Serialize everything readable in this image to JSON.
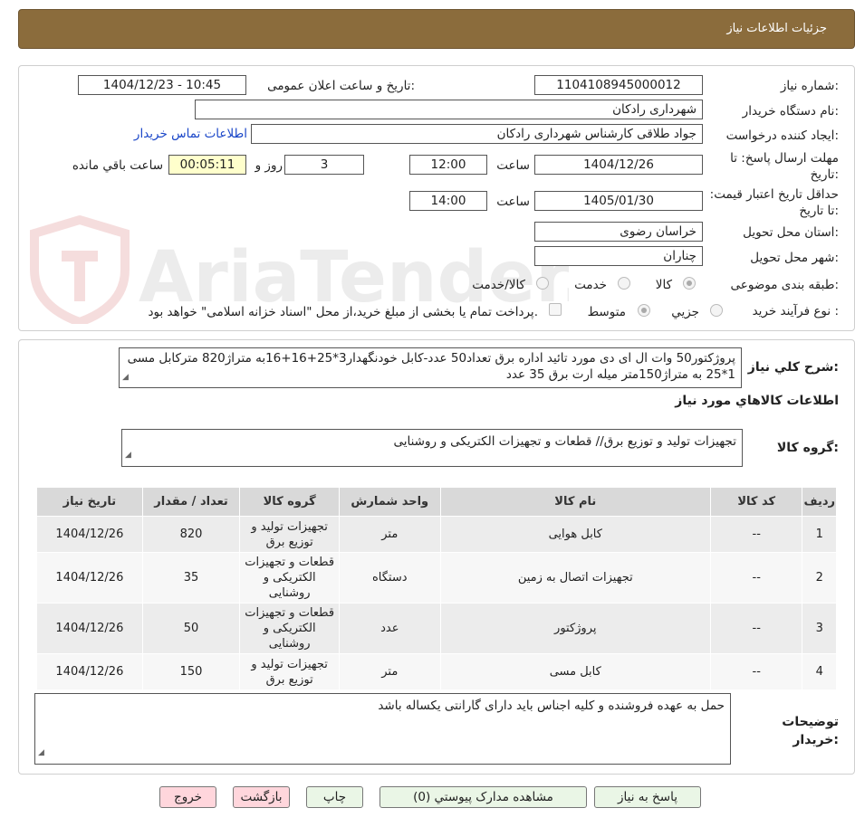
{
  "header": {
    "title": "جزئیات اطلاعات نیاز"
  },
  "labels": {
    "need_number": "شماره نیاز:",
    "announce_datetime": "تاریخ و ساعت اعلان عمومی:",
    "buyer_org": "نام دستگاه خریدار:",
    "requester": "ایجاد کننده درخواست:",
    "contact_link": "اطلاعات تماس خریدار",
    "reply_deadline": "مهلت ارسال پاسخ: تا تاریخ:",
    "time_word": "ساعت",
    "days_and": "روز و",
    "remaining": "ساعت باقي مانده",
    "validity": "حداقل تاریخ اعتبار قیمت: تا تاریخ:",
    "province": "استان محل تحویل:",
    "city": "شهر محل تحویل:",
    "category": "طبقه بندی موضوعی:",
    "process": "نوع فرآیند خرید :",
    "general_desc": "شرح کلي نياز:",
    "goods_info": "اطلاعات کالاهاي مورد نياز",
    "goods_group": "گروه کالا:",
    "buyer_notes": "توضیحات خریدار:"
  },
  "values": {
    "need_number": "1104108945000012",
    "announce_datetime": "1404/12/23 - 10:45",
    "buyer_org": "شهرداری رادکان",
    "requester": "جواد طلاقی کارشناس شهرداری رادکان",
    "reply_date": "1404/12/26",
    "reply_time": "12:00",
    "days": "3",
    "remaining_time": "00:05:11",
    "validity_date": "1405/01/30",
    "validity_time": "14:00",
    "province": "خراسان رضوی",
    "city": "چناران"
  },
  "category_options": [
    {
      "label": "کالا",
      "selected": true
    },
    {
      "label": "خدمت",
      "selected": false
    },
    {
      "label": "کالا/خدمت",
      "selected": false
    }
  ],
  "process_options": [
    {
      "label": "جزیي",
      "selected": false
    },
    {
      "label": "متوسط",
      "selected": true
    }
  ],
  "process_note": "پرداخت تمام یا بخشی از مبلغ خرید،از محل \"اسناد خزانه اسلامی\" خواهد بود.",
  "general_desc_text": "پروژکتور50 وات ال ای دی مورد تائید اداره برق تعداد50 عدد-کابل خودنگهدار3*25+16+16به متراژ820 متر‌کابل مسی 1*25 به متراژ150متر میله ارت برق 35 عدد",
  "goods_group_text": "تجهیزات تولید و توزیع برق// قطعات و تجهیزات الکتریکی و روشنایی",
  "table": {
    "headers": [
      "ردیف",
      "کد کالا",
      "نام کالا",
      "واحد شمارش",
      "گروه کالا",
      "تعداد / مقدار",
      "تاریخ نیاز"
    ],
    "rows": [
      {
        "idx": "1",
        "code": "--",
        "name": "کابل هوایی",
        "unit": "متر",
        "group": "تجهیزات تولید و توزیع برق",
        "qty": "820",
        "date": "1404/12/26"
      },
      {
        "idx": "2",
        "code": "--",
        "name": "تجهیزات اتصال به زمین",
        "unit": "دستگاه",
        "group": "قطعات و تجهیزات الکتریکی و روشنایی",
        "qty": "35",
        "date": "1404/12/26"
      },
      {
        "idx": "3",
        "code": "--",
        "name": "پروژکتور",
        "unit": "عدد",
        "group": "قطعات و تجهیزات الکتریکی و روشنایی",
        "qty": "50",
        "date": "1404/12/26"
      },
      {
        "idx": "4",
        "code": "--",
        "name": "کابل مسی",
        "unit": "متر",
        "group": "تجهیزات تولید و توزیع برق",
        "qty": "150",
        "date": "1404/12/26"
      }
    ]
  },
  "buyer_notes_text": "حمل به عهده فروشنده و کلیه اجناس باید دارای گارانتی یکساله باشد",
  "buttons": {
    "reply": "پاسخ به نیاز",
    "attachments": "مشاهده مدارک پیوستي (0)",
    "print": "چاپ",
    "back": "بازگشت",
    "exit": "خروج"
  },
  "watermark": "AriaTender.neT",
  "colors": {
    "header_bg": "#8b6c3c",
    "link": "#1a46c8",
    "button_green": "#eaf6e6",
    "button_pink": "#ffd6dc"
  }
}
